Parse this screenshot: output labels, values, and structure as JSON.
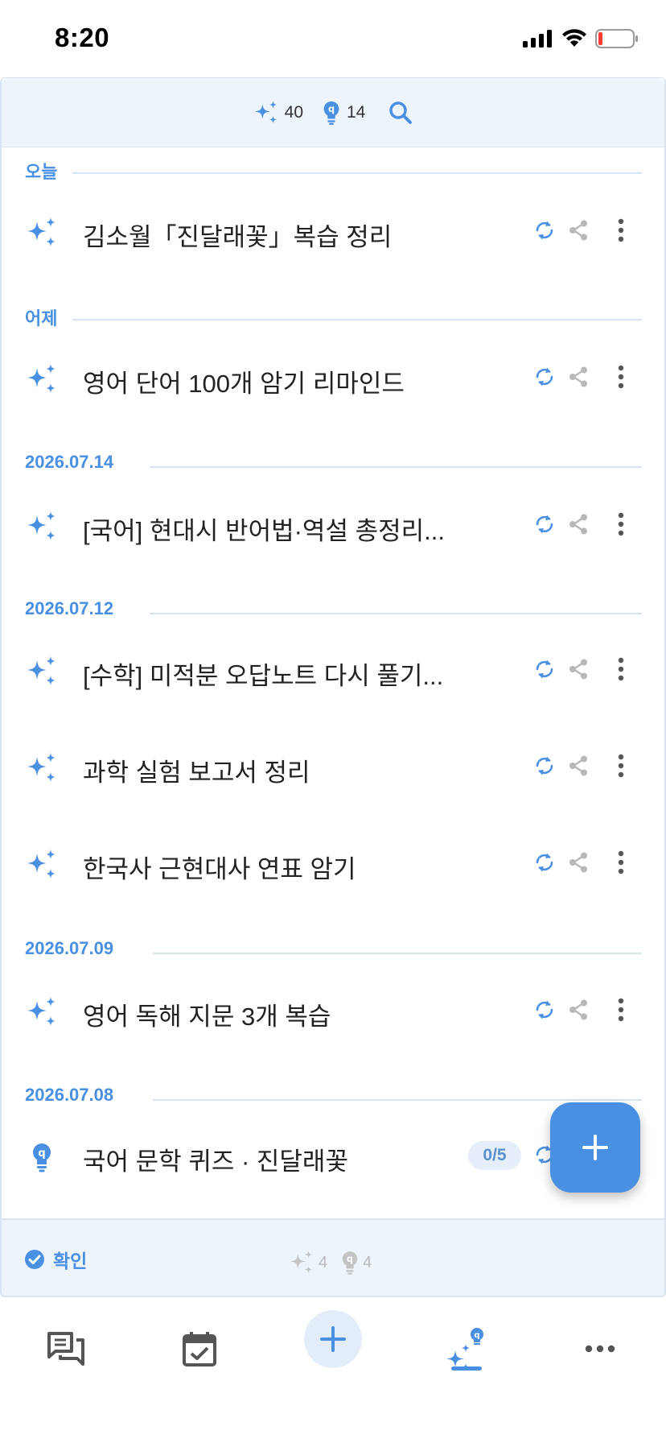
{
  "status_bar": {
    "time": "8:20"
  },
  "header": {
    "sparkle_count": "40",
    "quiz_count": "14"
  },
  "sections": [
    {
      "label": "오늘"
    },
    {
      "label": "어제"
    },
    {
      "label": "2026.07.14"
    },
    {
      "label": "2026.07.12"
    },
    {
      "label": "2026.07.09"
    },
    {
      "label": "2026.07.08"
    }
  ],
  "items": [
    {
      "title": "김소월「진달래꽃」복습 정리",
      "type": "sparkle"
    },
    {
      "title": "영어 단어 100개 암기 리마인드",
      "type": "sparkle"
    },
    {
      "title": "[국어] 현대시 반어법·역설 총정리...",
      "type": "sparkle"
    },
    {
      "title": "[수학] 미적분 오답노트 다시 풀기...",
      "type": "sparkle"
    },
    {
      "title": "과학 실험 보고서 정리",
      "type": "sparkle"
    },
    {
      "title": "한국사 근현대사 연표 암기",
      "type": "sparkle"
    },
    {
      "title": "영어 독해 지문 3개 복습",
      "type": "sparkle"
    },
    {
      "title": "국어 문학 퀴즈 · 진달래꽃",
      "type": "quiz",
      "badge": "0/5"
    }
  ],
  "footer": {
    "confirm_label": "확인",
    "sparkle_count": "4",
    "quiz_count": "4"
  },
  "colors": {
    "accent": "#4a90e2",
    "header_bg": "#eef4fc",
    "divider": "#d6e6f7"
  },
  "icons": {
    "lead_sparkle": "sparkles-icon",
    "lead_quiz": "lightbulb-q-icon",
    "refresh": "refresh-icon",
    "share": "share-icon",
    "more": "more-vertical-icon",
    "fab": "plus-icon",
    "tabs": [
      "chat-icon",
      "calendar-check-icon",
      "plus-icon",
      "sparkles-quiz-icon",
      "more-horizontal-icon"
    ]
  }
}
